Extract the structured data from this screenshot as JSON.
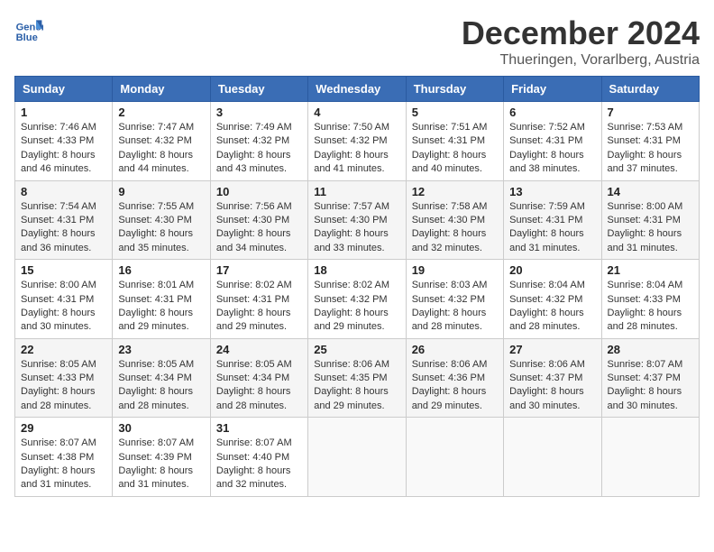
{
  "header": {
    "logo_line1": "General",
    "logo_line2": "Blue",
    "month_title": "December 2024",
    "location": "Thueringen, Vorarlberg, Austria"
  },
  "weekdays": [
    "Sunday",
    "Monday",
    "Tuesday",
    "Wednesday",
    "Thursday",
    "Friday",
    "Saturday"
  ],
  "weeks": [
    [
      {
        "day": "1",
        "sunrise": "Sunrise: 7:46 AM",
        "sunset": "Sunset: 4:33 PM",
        "daylight": "Daylight: 8 hours and 46 minutes."
      },
      {
        "day": "2",
        "sunrise": "Sunrise: 7:47 AM",
        "sunset": "Sunset: 4:32 PM",
        "daylight": "Daylight: 8 hours and 44 minutes."
      },
      {
        "day": "3",
        "sunrise": "Sunrise: 7:49 AM",
        "sunset": "Sunset: 4:32 PM",
        "daylight": "Daylight: 8 hours and 43 minutes."
      },
      {
        "day": "4",
        "sunrise": "Sunrise: 7:50 AM",
        "sunset": "Sunset: 4:32 PM",
        "daylight": "Daylight: 8 hours and 41 minutes."
      },
      {
        "day": "5",
        "sunrise": "Sunrise: 7:51 AM",
        "sunset": "Sunset: 4:31 PM",
        "daylight": "Daylight: 8 hours and 40 minutes."
      },
      {
        "day": "6",
        "sunrise": "Sunrise: 7:52 AM",
        "sunset": "Sunset: 4:31 PM",
        "daylight": "Daylight: 8 hours and 38 minutes."
      },
      {
        "day": "7",
        "sunrise": "Sunrise: 7:53 AM",
        "sunset": "Sunset: 4:31 PM",
        "daylight": "Daylight: 8 hours and 37 minutes."
      }
    ],
    [
      {
        "day": "8",
        "sunrise": "Sunrise: 7:54 AM",
        "sunset": "Sunset: 4:31 PM",
        "daylight": "Daylight: 8 hours and 36 minutes."
      },
      {
        "day": "9",
        "sunrise": "Sunrise: 7:55 AM",
        "sunset": "Sunset: 4:30 PM",
        "daylight": "Daylight: 8 hours and 35 minutes."
      },
      {
        "day": "10",
        "sunrise": "Sunrise: 7:56 AM",
        "sunset": "Sunset: 4:30 PM",
        "daylight": "Daylight: 8 hours and 34 minutes."
      },
      {
        "day": "11",
        "sunrise": "Sunrise: 7:57 AM",
        "sunset": "Sunset: 4:30 PM",
        "daylight": "Daylight: 8 hours and 33 minutes."
      },
      {
        "day": "12",
        "sunrise": "Sunrise: 7:58 AM",
        "sunset": "Sunset: 4:30 PM",
        "daylight": "Daylight: 8 hours and 32 minutes."
      },
      {
        "day": "13",
        "sunrise": "Sunrise: 7:59 AM",
        "sunset": "Sunset: 4:31 PM",
        "daylight": "Daylight: 8 hours and 31 minutes."
      },
      {
        "day": "14",
        "sunrise": "Sunrise: 8:00 AM",
        "sunset": "Sunset: 4:31 PM",
        "daylight": "Daylight: 8 hours and 31 minutes."
      }
    ],
    [
      {
        "day": "15",
        "sunrise": "Sunrise: 8:00 AM",
        "sunset": "Sunset: 4:31 PM",
        "daylight": "Daylight: 8 hours and 30 minutes."
      },
      {
        "day": "16",
        "sunrise": "Sunrise: 8:01 AM",
        "sunset": "Sunset: 4:31 PM",
        "daylight": "Daylight: 8 hours and 29 minutes."
      },
      {
        "day": "17",
        "sunrise": "Sunrise: 8:02 AM",
        "sunset": "Sunset: 4:31 PM",
        "daylight": "Daylight: 8 hours and 29 minutes."
      },
      {
        "day": "18",
        "sunrise": "Sunrise: 8:02 AM",
        "sunset": "Sunset: 4:32 PM",
        "daylight": "Daylight: 8 hours and 29 minutes."
      },
      {
        "day": "19",
        "sunrise": "Sunrise: 8:03 AM",
        "sunset": "Sunset: 4:32 PM",
        "daylight": "Daylight: 8 hours and 28 minutes."
      },
      {
        "day": "20",
        "sunrise": "Sunrise: 8:04 AM",
        "sunset": "Sunset: 4:32 PM",
        "daylight": "Daylight: 8 hours and 28 minutes."
      },
      {
        "day": "21",
        "sunrise": "Sunrise: 8:04 AM",
        "sunset": "Sunset: 4:33 PM",
        "daylight": "Daylight: 8 hours and 28 minutes."
      }
    ],
    [
      {
        "day": "22",
        "sunrise": "Sunrise: 8:05 AM",
        "sunset": "Sunset: 4:33 PM",
        "daylight": "Daylight: 8 hours and 28 minutes."
      },
      {
        "day": "23",
        "sunrise": "Sunrise: 8:05 AM",
        "sunset": "Sunset: 4:34 PM",
        "daylight": "Daylight: 8 hours and 28 minutes."
      },
      {
        "day": "24",
        "sunrise": "Sunrise: 8:05 AM",
        "sunset": "Sunset: 4:34 PM",
        "daylight": "Daylight: 8 hours and 28 minutes."
      },
      {
        "day": "25",
        "sunrise": "Sunrise: 8:06 AM",
        "sunset": "Sunset: 4:35 PM",
        "daylight": "Daylight: 8 hours and 29 minutes."
      },
      {
        "day": "26",
        "sunrise": "Sunrise: 8:06 AM",
        "sunset": "Sunset: 4:36 PM",
        "daylight": "Daylight: 8 hours and 29 minutes."
      },
      {
        "day": "27",
        "sunrise": "Sunrise: 8:06 AM",
        "sunset": "Sunset: 4:37 PM",
        "daylight": "Daylight: 8 hours and 30 minutes."
      },
      {
        "day": "28",
        "sunrise": "Sunrise: 8:07 AM",
        "sunset": "Sunset: 4:37 PM",
        "daylight": "Daylight: 8 hours and 30 minutes."
      }
    ],
    [
      {
        "day": "29",
        "sunrise": "Sunrise: 8:07 AM",
        "sunset": "Sunset: 4:38 PM",
        "daylight": "Daylight: 8 hours and 31 minutes."
      },
      {
        "day": "30",
        "sunrise": "Sunrise: 8:07 AM",
        "sunset": "Sunset: 4:39 PM",
        "daylight": "Daylight: 8 hours and 31 minutes."
      },
      {
        "day": "31",
        "sunrise": "Sunrise: 8:07 AM",
        "sunset": "Sunset: 4:40 PM",
        "daylight": "Daylight: 8 hours and 32 minutes."
      },
      null,
      null,
      null,
      null
    ]
  ]
}
